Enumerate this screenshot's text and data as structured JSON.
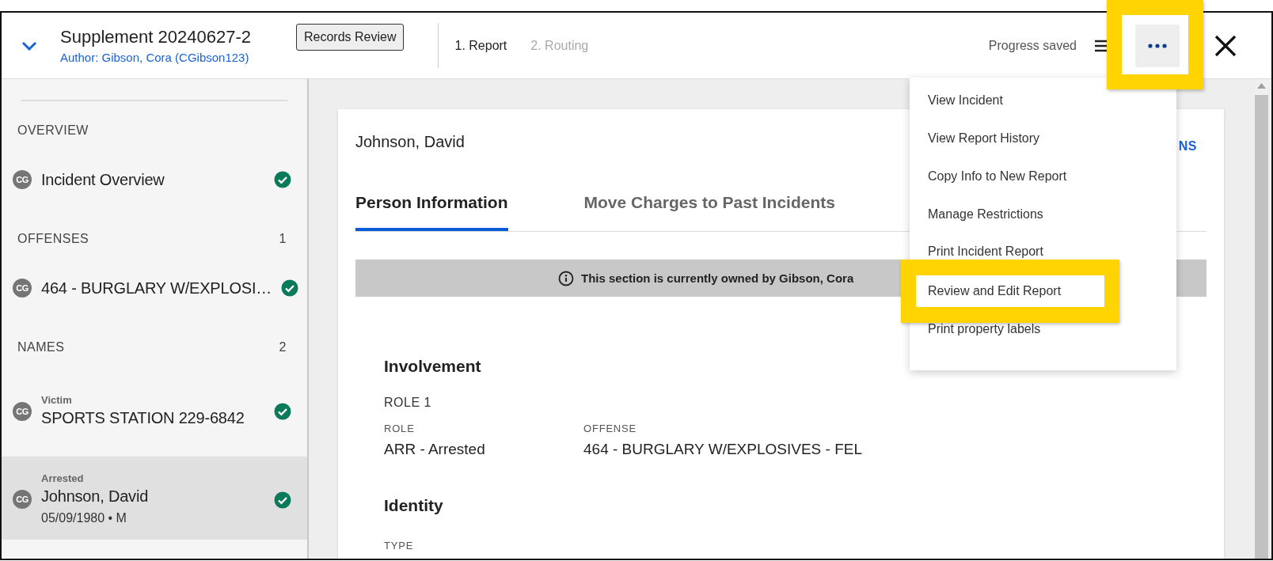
{
  "header": {
    "title": "Supplement 20240627-2",
    "author": "Author: Gibson, Cora (CGibson123)",
    "badge": "Records Review",
    "steps": [
      {
        "label": "1. Report",
        "selected": true
      },
      {
        "label": "2. Routing",
        "selected": false
      }
    ],
    "status": "Progress saved",
    "more_button": {
      "highlighted": true
    }
  },
  "sidebar": {
    "sections": [
      {
        "title": "OVERVIEW",
        "items": [
          {
            "avatar": "CG",
            "label": "Incident Overview",
            "complete": true,
            "selected": false
          }
        ]
      },
      {
        "title": "OFFENSES",
        "count": "1",
        "items": [
          {
            "avatar": "CG",
            "label": "464 - BURGLARY W/EXPLOSI…",
            "complete": true,
            "selected": false
          }
        ]
      },
      {
        "title": "NAMES",
        "count": "2",
        "items": [
          {
            "avatar": "CG",
            "role": "Victim",
            "label": "SPORTS STATION 229-6842",
            "complete": true,
            "selected": false
          },
          {
            "avatar": "CG",
            "role": "Arrested",
            "label": "Johnson, David",
            "detail": "05/09/1980 • M",
            "complete": true,
            "selected": true
          }
        ]
      }
    ]
  },
  "card": {
    "title": "Johnson, David",
    "action_partial": "NS",
    "tabs": [
      {
        "label": "Person Information",
        "selected": true
      },
      {
        "label": "Move Charges to Past Incidents",
        "selected": false
      }
    ],
    "notice": "This section is currently owned by Gibson, Cora",
    "sections": [
      {
        "heading": "Involvement",
        "subheading": "ROLE 1",
        "fields": [
          {
            "label": "ROLE",
            "value": "ARR - Arrested"
          },
          {
            "label": "OFFENSE",
            "value": "464 - BURGLARY W/EXPLOSIVES - FEL"
          }
        ]
      },
      {
        "heading": "Identity",
        "fields": [
          {
            "label": "TYPE"
          }
        ]
      }
    ]
  },
  "menu": {
    "items": [
      {
        "label": "View Incident",
        "highlighted": false
      },
      {
        "label": "View Report History",
        "highlighted": false
      },
      {
        "label": "Copy Info to New Report",
        "highlighted": false
      },
      {
        "label": "Manage Restrictions",
        "highlighted": false
      },
      {
        "label": "Print Incident Report",
        "highlighted": false
      },
      {
        "label": "Review and Edit Report",
        "highlighted": true
      },
      {
        "label": "Print property labels",
        "highlighted": false
      }
    ]
  }
}
